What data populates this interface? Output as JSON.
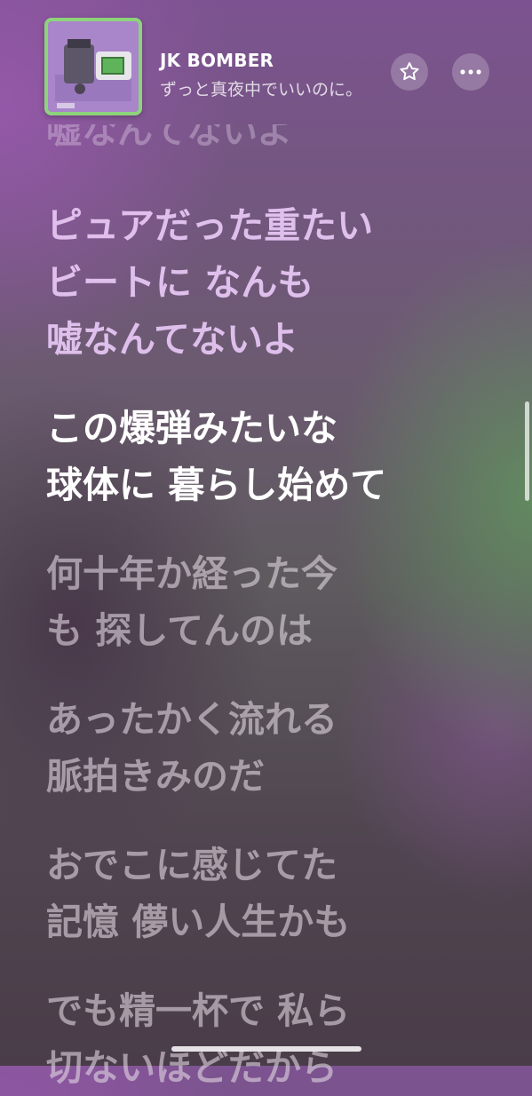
{
  "song": {
    "title": "JK BOMBER",
    "artist": "ずっと真夜中でいいのに。"
  },
  "icons": {
    "favorite": "star-icon",
    "more": "ellipsis-icon",
    "artwork": "album-artwork"
  },
  "colors": {
    "active_lyric": "#ffffff",
    "artwork_border": "#8ed37b"
  },
  "lyrics": {
    "previous_partial": "嘘なんてないよ",
    "verses": [
      {
        "state": "past",
        "lines": [
          "ピュアだった重たい",
          "ビートに なんも",
          "嘘なんてないよ"
        ]
      },
      {
        "state": "current",
        "lines": [
          "この爆弾みたいな",
          "球体に 暮らし始めて"
        ]
      },
      {
        "state": "upcoming",
        "lines": [
          "何十年か経った今",
          "も 探してんのは"
        ]
      },
      {
        "state": "upcoming",
        "lines": [
          "あったかく流れる",
          "脈拍きみのだ"
        ]
      },
      {
        "state": "upcoming",
        "lines": [
          "おでこに感じてた",
          "記憶 儚い人生かも"
        ]
      },
      {
        "state": "upcoming",
        "lines": [
          "でも精一杯で 私ら",
          "切ないほどだから"
        ]
      }
    ]
  }
}
